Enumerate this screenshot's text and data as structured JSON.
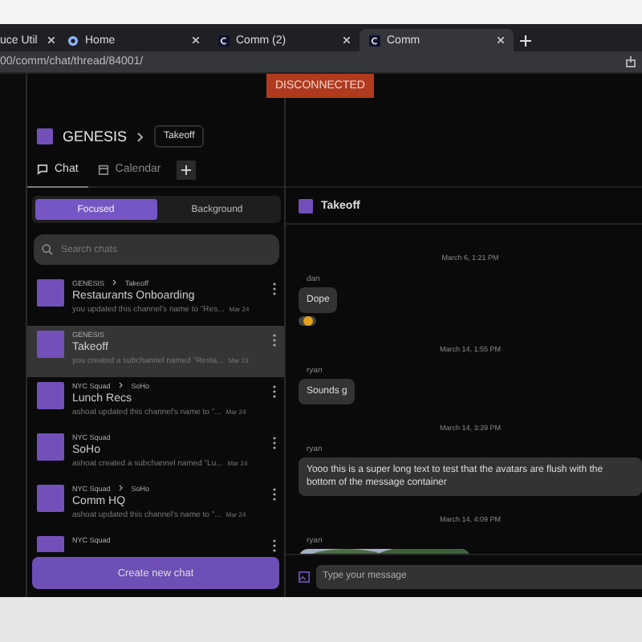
{
  "browser_tabs": [
    {
      "title": "uce Util",
      "selected": false
    },
    {
      "title": "Home",
      "selected": false
    },
    {
      "title": "Comm (2)",
      "selected": false
    },
    {
      "title": "Comm",
      "selected": true
    }
  ],
  "address": "00/comm/chat/thread/84001/",
  "banner": "DISCONNECTED",
  "breadcrumb": {
    "community": "GENESIS",
    "thread": "Takeoff"
  },
  "tabs": [
    {
      "label": "Chat",
      "selected": true
    },
    {
      "label": "Calendar",
      "selected": false
    }
  ],
  "filter": [
    {
      "label": "Focused",
      "selected": true
    },
    {
      "label": "Background",
      "selected": false
    }
  ],
  "search": {
    "placeholder": "Search chats"
  },
  "chats": [
    {
      "path": [
        "GENESIS",
        "Takeoff"
      ],
      "name": "Restaurants Onboarding",
      "preview": "you updated this channel's name to \"Res...",
      "date": "Mar 24",
      "selected": false
    },
    {
      "path": [
        "GENESIS"
      ],
      "name": "Takeoff",
      "preview": "you created a subchannel named \"Resta...",
      "date": "Mar 23",
      "selected": true
    },
    {
      "path": [
        "NYC Squad",
        "SoHo"
      ],
      "name": "Lunch Recs",
      "preview": "ashoat updated this channel's name to \"...",
      "date": "Mar 24",
      "selected": false
    },
    {
      "path": [
        "NYC Squad"
      ],
      "name": "SoHo",
      "preview": "ashoat created a subchannel named \"Lu...",
      "date": "Mar 24",
      "selected": false
    },
    {
      "path": [
        "NYC Squad",
        "SoHo"
      ],
      "name": "Comm HQ",
      "preview": "ashoat updated this channel's name to \"...",
      "date": "Mar 24",
      "selected": false
    },
    {
      "path": [
        "NYC Squad"
      ],
      "selected": false
    }
  ],
  "create_button": "Create new chat",
  "thread": {
    "title": "Takeoff",
    "messages": [
      {
        "kind": "time",
        "text": "March 6, 1:21 PM"
      },
      {
        "kind": "author",
        "text": "dan"
      },
      {
        "kind": "text",
        "text": "Dope"
      },
      {
        "kind": "reaction"
      },
      {
        "kind": "time",
        "text": "March 14, 1:55 PM"
      },
      {
        "kind": "author",
        "text": "ryan"
      },
      {
        "kind": "text",
        "text": "Sounds g"
      },
      {
        "kind": "time",
        "text": "March 14, 3:39 PM"
      },
      {
        "kind": "author",
        "text": "ryan"
      },
      {
        "kind": "text",
        "text": "Yooo this is a super long text to test that the avatars are flush with the bottom of the message container"
      },
      {
        "kind": "time",
        "text": "March 14, 4:09 PM"
      },
      {
        "kind": "author",
        "text": "ryan"
      },
      {
        "kind": "picture"
      }
    ],
    "composer": {
      "placeholder": "Type your message"
    }
  }
}
